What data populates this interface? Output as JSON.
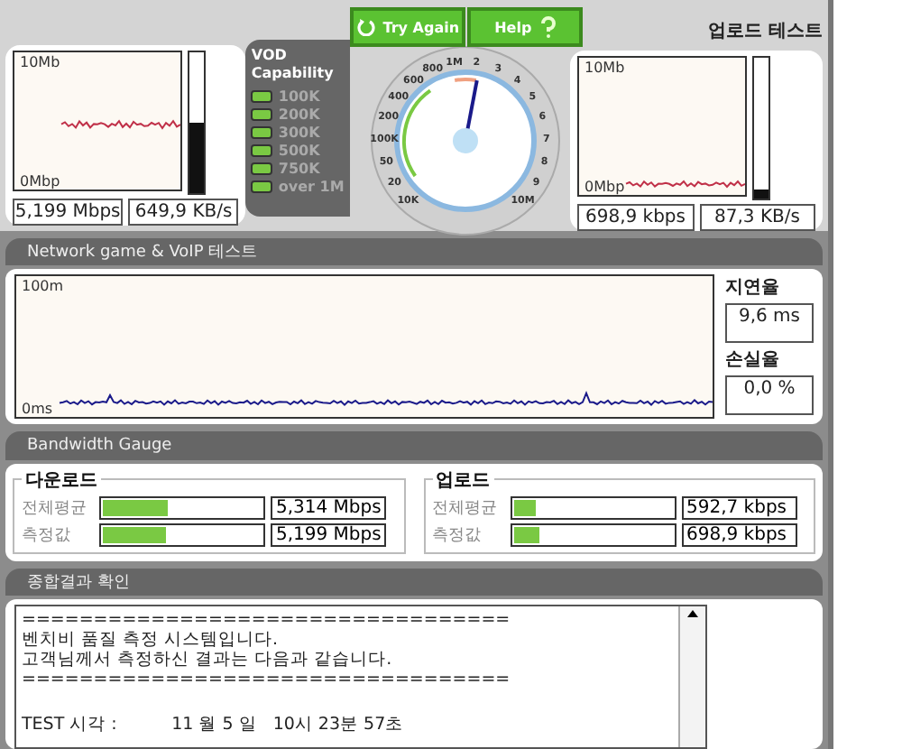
{
  "download": {
    "y_max_label": "10Mb",
    "y_min_label": "0Mbp",
    "level": 0.5,
    "speed": "5,199 Mbps",
    "rate": "649,9 KB/s"
  },
  "vod": {
    "title": "VOD Capability",
    "items": [
      {
        "label": "100K",
        "on": true
      },
      {
        "label": "200K",
        "on": true
      },
      {
        "label": "300K",
        "on": true
      },
      {
        "label": "500K",
        "on": true
      },
      {
        "label": "750K",
        "on": true
      },
      {
        "label": "over 1M",
        "on": true
      }
    ]
  },
  "buttons": [
    {
      "label": "Try Again",
      "kind": "retry"
    },
    {
      "label": "Help",
      "kind": "help"
    }
  ],
  "gauge": {
    "level": 0.54,
    "left_labels": [
      "800",
      "600",
      "400",
      "200",
      "100K",
      "50",
      "20",
      "10K"
    ],
    "right_labels": [
      "1M",
      "2",
      "3",
      "4",
      "5",
      "6",
      "7",
      "8",
      "9",
      "10M"
    ]
  },
  "upload": {
    "title": "업로드 테스트",
    "y_max_label": "10Mb",
    "y_min_label": "0Mbp",
    "level": 0.06,
    "speed": "698,9 kbps",
    "rate": "87,3 KB/s"
  },
  "voip": {
    "header": "Network game & VoIP 테스트",
    "y_max_label": "100m",
    "y_min_label": "0ms",
    "latency_label": "지연율",
    "latency": "9,6 ms",
    "loss_label": "손실율",
    "loss": "0,0 %"
  },
  "bandwidth": {
    "header": "Bandwidth Gauge",
    "groups": [
      {
        "title": "다운로드",
        "rows": [
          {
            "label": "전체평균",
            "level": 0.41,
            "value": "5,314 Mbps"
          },
          {
            "label": "측정값",
            "level": 0.4,
            "value": "5,199 Mbps"
          }
        ]
      },
      {
        "title": "업로드",
        "rows": [
          {
            "label": "전체평균",
            "level": 0.14,
            "value": "592,7 kbps"
          },
          {
            "label": "측정값",
            "level": 0.17,
            "value": "698,9 kbps"
          }
        ]
      }
    ]
  },
  "summary": {
    "header": "종합결과 확인",
    "lines": [
      "==================================",
      "벤치비 품질 측정 시스템입니다.",
      "고객님께서 측정하신 결과는 다음과 같습니다.",
      "=================================="
    ],
    "footer_line": "TEST 시각 :          11 월 5 일   10시 23분 57초"
  }
}
